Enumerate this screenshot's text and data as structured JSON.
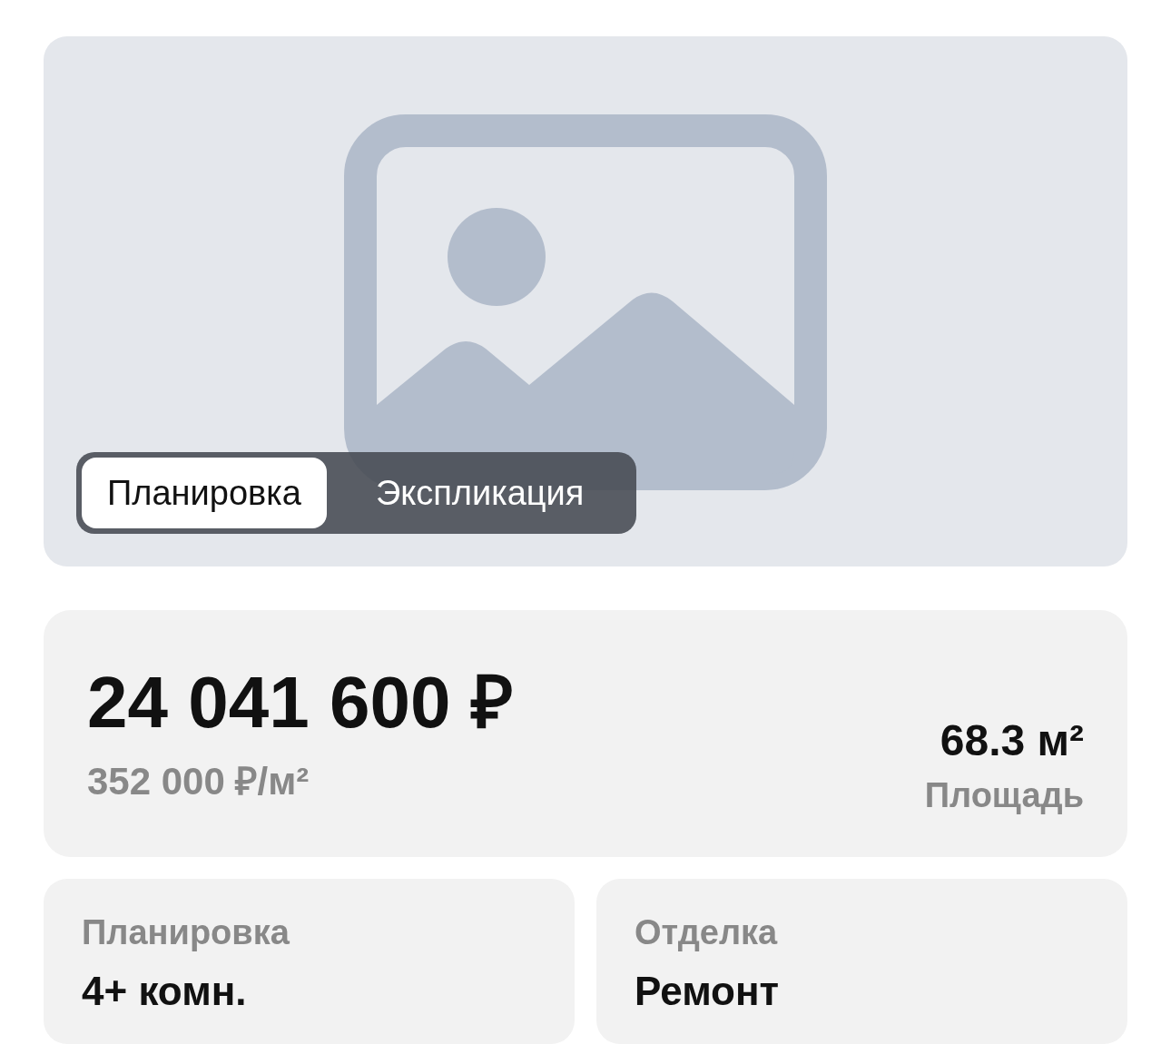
{
  "gallery": {
    "view_switch": [
      {
        "label": "Планировка",
        "selected": true
      },
      {
        "label": "Экспликация",
        "selected": false
      }
    ]
  },
  "price_card": {
    "price": "24 041 600 ₽",
    "price_per_m2": "352 000 ₽/м²",
    "area": {
      "value": "68.3 м²",
      "label": "Площадь"
    }
  },
  "details": [
    {
      "label": "Планировка",
      "value": "4+ комн."
    },
    {
      "label": "Отделка",
      "value": "Ремонт"
    }
  ]
}
